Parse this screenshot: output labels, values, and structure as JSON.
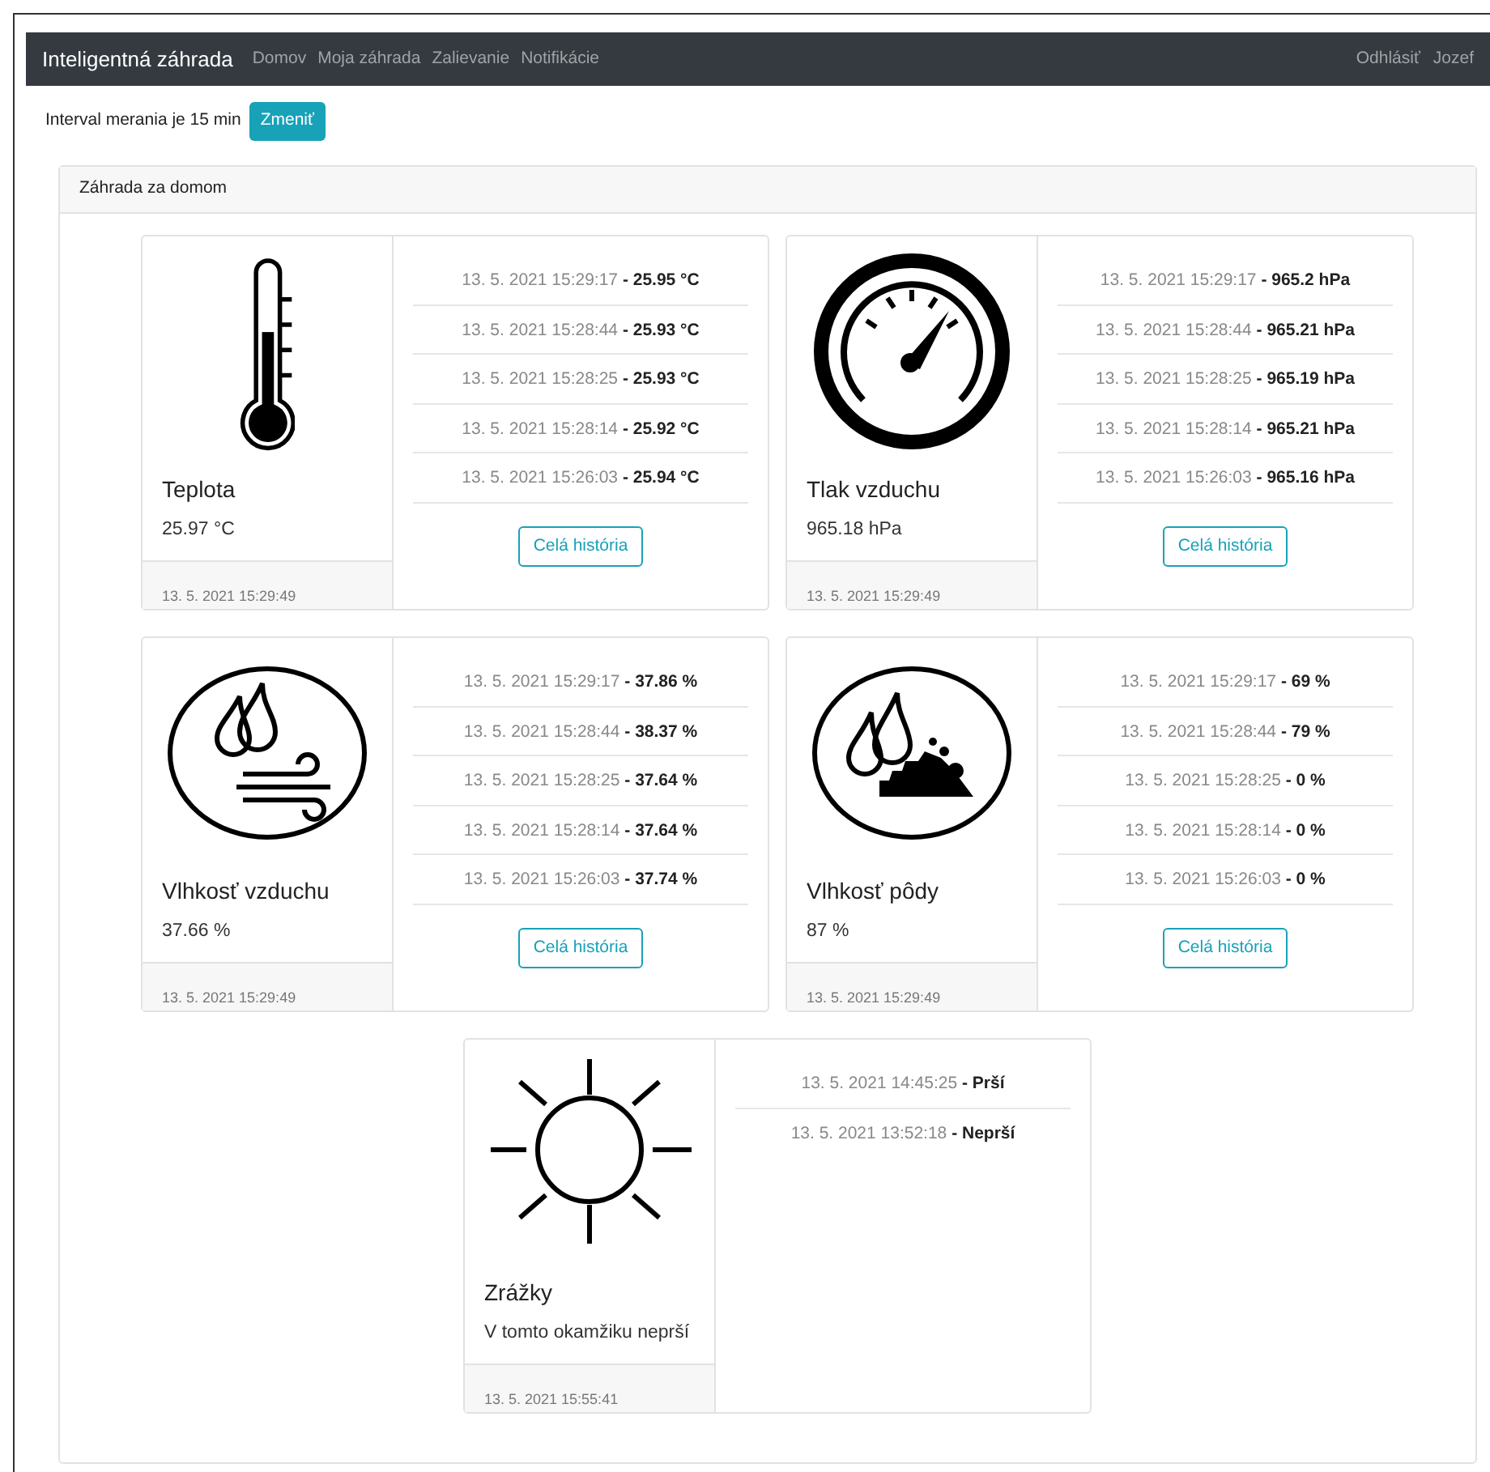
{
  "navbar": {
    "brand": "Inteligentná záhrada",
    "links": [
      {
        "label": "Domov"
      },
      {
        "label": "Moja záhrada"
      },
      {
        "label": "Zalievanie"
      },
      {
        "label": "Notifikácie"
      }
    ],
    "right_links": [
      {
        "label": "Odhlásiť"
      },
      {
        "label": "Jozef"
      }
    ]
  },
  "interval": {
    "text": "Interval merania je 15 min",
    "button": "Zmeniť"
  },
  "panel": {
    "title": "Záhrada za domom",
    "sensors": [
      {
        "kind": "thermometer",
        "name": "Teplota",
        "value": "25.97 °C",
        "updated": "13. 5. 2021 15:29:49",
        "history": [
          {
            "time": "13. 5. 2021 15:29:17",
            "value": "- 25.95 °C"
          },
          {
            "time": "13. 5. 2021 15:28:44",
            "value": "- 25.93 °C"
          },
          {
            "time": "13. 5. 2021 15:28:25",
            "value": "- 25.93 °C"
          },
          {
            "time": "13. 5. 2021 15:28:14",
            "value": "- 25.92 °C"
          },
          {
            "time": "13. 5. 2021 15:26:03",
            "value": "- 25.94 °C"
          }
        ],
        "button": "Celá história"
      },
      {
        "kind": "gauge",
        "name": "Tlak vzduchu",
        "value": "965.18 hPa",
        "updated": "13. 5. 2021 15:29:49",
        "history": [
          {
            "time": "13. 5. 2021 15:29:17",
            "value": "- 965.2 hPa"
          },
          {
            "time": "13. 5. 2021 15:28:44",
            "value": "- 965.21 hPa"
          },
          {
            "time": "13. 5. 2021 15:28:25",
            "value": "- 965.19 hPa"
          },
          {
            "time": "13. 5. 2021 15:28:14",
            "value": "- 965.21 hPa"
          },
          {
            "time": "13. 5. 2021 15:26:03",
            "value": "- 965.16 hPa"
          }
        ],
        "button": "Celá história"
      },
      {
        "kind": "air-humidity",
        "name": "Vlhkosť vzduchu",
        "value": "37.66 %",
        "updated": "13. 5. 2021 15:29:49",
        "history": [
          {
            "time": "13. 5. 2021 15:29:17",
            "value": "- 37.86 %"
          },
          {
            "time": "13. 5. 2021 15:28:44",
            "value": "- 38.37 %"
          },
          {
            "time": "13. 5. 2021 15:28:25",
            "value": "- 37.64 %"
          },
          {
            "time": "13. 5. 2021 15:28:14",
            "value": "- 37.64 %"
          },
          {
            "time": "13. 5. 2021 15:26:03",
            "value": "- 37.74 %"
          }
        ],
        "button": "Celá história"
      },
      {
        "kind": "soil-humidity",
        "name": "Vlhkosť pôdy",
        "value": "87 %",
        "updated": "13. 5. 2021 15:29:49",
        "history": [
          {
            "time": "13. 5. 2021 15:29:17",
            "value": "- 69 %"
          },
          {
            "time": "13. 5. 2021 15:28:44",
            "value": "- 79 %"
          },
          {
            "time": "13. 5. 2021 15:28:25",
            "value": "- 0 %"
          },
          {
            "time": "13. 5. 2021 15:28:14",
            "value": "- 0 %"
          },
          {
            "time": "13. 5. 2021 15:26:03",
            "value": "- 0 %"
          }
        ],
        "button": "Celá história"
      },
      {
        "kind": "sun",
        "name": "Zrážky",
        "value": "V tomto okamžiku neprší",
        "updated": "13. 5. 2021 15:55:41",
        "history": [
          {
            "time": "13. 5. 2021 14:45:25",
            "value": "- Prší"
          },
          {
            "time": "13. 5. 2021 13:52:18",
            "value": "- Neprší"
          }
        ]
      }
    ]
  }
}
